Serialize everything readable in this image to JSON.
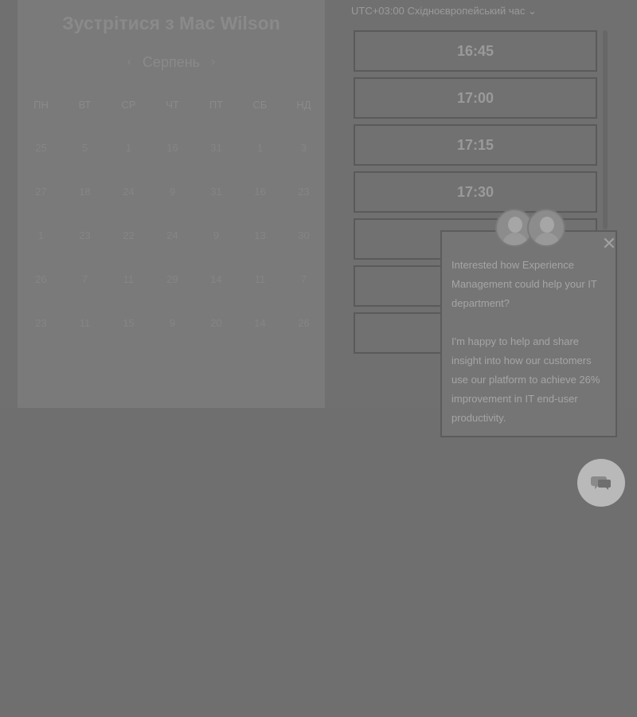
{
  "calendar": {
    "title": "Зустрітися з Мас Wilson",
    "month": "Серпень",
    "prev_icon": "chevron-left-icon",
    "next_icon": "chevron-right-icon",
    "weekdays": [
      "ПН",
      "ВТ",
      "СР",
      "ЧТ",
      "ПТ",
      "СБ",
      "НД"
    ],
    "days": [
      "25",
      "5",
      "1",
      "16",
      "31",
      "1",
      "3",
      "27",
      "18",
      "24",
      "9",
      "31",
      "16",
      "23",
      "1",
      "23",
      "22",
      "24",
      "9",
      "13",
      "30",
      "26",
      "7",
      "11",
      "29",
      "14",
      "11",
      "7",
      "23",
      "11",
      "15",
      "9",
      "20",
      "14",
      "26"
    ]
  },
  "scheduler": {
    "timezone_label": "UTC+03:00 Східноєвропейський час",
    "slots": [
      "16:45",
      "17:00",
      "17:15",
      "17:30",
      "",
      "",
      "",
      ""
    ]
  },
  "popup": {
    "paragraph_1": "Interested how Experience Management could help your IT department?",
    "paragraph_2": "I'm happy to help and share insight into how our customers use our platform to achieve 26% improvement in IT end-user productivity.",
    "close_icon": "close-icon"
  },
  "chat_button": {
    "icon": "chat-icon"
  }
}
